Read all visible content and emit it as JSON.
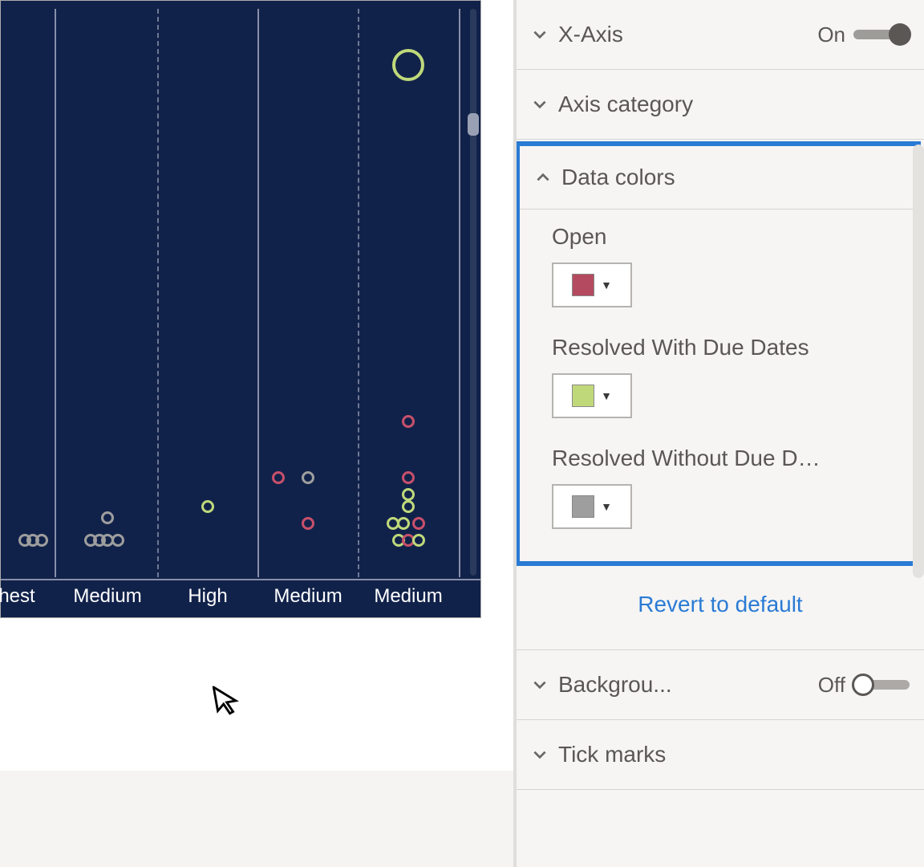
{
  "chart_data": {
    "type": "scatter",
    "title": "",
    "xlabel": "",
    "ylabel": "",
    "x_categories_visible": [
      "hest",
      "Medium",
      "High",
      "Medium",
      "Medium"
    ],
    "ylim": [
      0,
      100
    ],
    "series": [
      {
        "name": "Open",
        "color": "#c8506b"
      },
      {
        "name": "Resolved With Due Dates",
        "color": "#bfd97a"
      },
      {
        "name": "Resolved Without Due Dates",
        "color": "#9e9e9e"
      }
    ],
    "points": [
      {
        "x": 4,
        "y": 90,
        "series": 1,
        "size": "big"
      },
      {
        "x": 4,
        "y": 27,
        "series": 0
      },
      {
        "x": 4,
        "y": 17,
        "series": 0
      },
      {
        "x": 4,
        "y": 14,
        "series": 1
      },
      {
        "x": 4,
        "y": 12,
        "series": 1
      },
      {
        "x": 3.85,
        "y": 9,
        "series": 1
      },
      {
        "x": 3.95,
        "y": 9,
        "series": 1
      },
      {
        "x": 4.1,
        "y": 9,
        "series": 0
      },
      {
        "x": 3.9,
        "y": 6,
        "series": 1
      },
      {
        "x": 4.0,
        "y": 6,
        "series": 0
      },
      {
        "x": 4.1,
        "y": 6,
        "series": 1
      },
      {
        "x": 3,
        "y": 9,
        "series": 0
      },
      {
        "x": 3,
        "y": 17,
        "series": 2
      },
      {
        "x": 2.7,
        "y": 17,
        "series": 0
      },
      {
        "x": 2,
        "y": 12,
        "series": 1
      },
      {
        "x": 1,
        "y": 10,
        "series": 2
      },
      {
        "x": 0.8,
        "y": 6,
        "series": 2
      },
      {
        "x": 0.9,
        "y": 6,
        "series": 2
      },
      {
        "x": 1.0,
        "y": 6,
        "series": 2
      },
      {
        "x": 1.1,
        "y": 6,
        "series": 2
      },
      {
        "x": 0.0,
        "y": 6,
        "series": 2
      },
      {
        "x": 0.1,
        "y": 6,
        "series": 2
      },
      {
        "x": 0.2,
        "y": 6,
        "series": 2
      }
    ]
  },
  "panel": {
    "sections": {
      "xaxis": {
        "label": "X-Axis",
        "toggle_label": "On",
        "on": true
      },
      "axis_category": {
        "label": "Axis category"
      },
      "data_colors": {
        "label": "Data colors",
        "items": [
          {
            "name": "Open",
            "color": "#b44a5f"
          },
          {
            "name": "Resolved With Due Dates",
            "color": "#bfd97a"
          },
          {
            "name": "Resolved Without Due Da...",
            "color": "#9e9e9e"
          }
        ],
        "revert_label": "Revert to default"
      },
      "background": {
        "label": "Backgrou...",
        "toggle_label": "Off",
        "on": false
      },
      "tick_marks": {
        "label": "Tick marks"
      }
    }
  }
}
